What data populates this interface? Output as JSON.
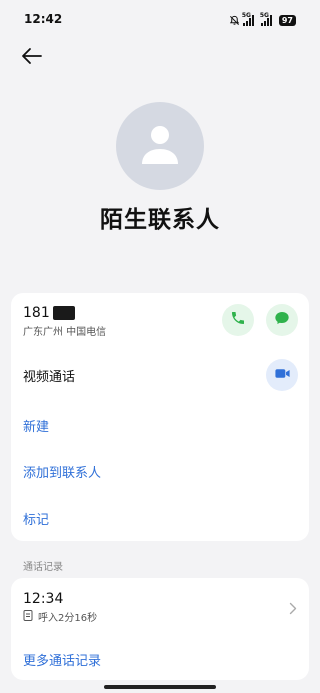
{
  "status_bar": {
    "time": "12:42",
    "sim1_tag": "5G",
    "sim2_tag": "5G",
    "battery": "97",
    "icons": [
      "bell-muted-icon",
      "signal-icon",
      "signal-icon",
      "battery-icon"
    ]
  },
  "header": {
    "back_icon": "arrow-left-icon"
  },
  "contact": {
    "avatar_icon": "person-icon",
    "name": "陌生联系人",
    "phone_number": "181",
    "location": "广东广州 中国电信"
  },
  "actions": {
    "call_icon": "phone-icon",
    "message_icon": "message-icon",
    "video_label": "视频通话",
    "video_icon": "video-camera-icon",
    "new_label": "新建",
    "add_to_contact_label": "添加到联系人",
    "mark_label": "标记"
  },
  "call_log": {
    "section_title": "通话记录",
    "entries": [
      {
        "time": "12:34",
        "detail": "呼入2分16秒",
        "icon": "call-incoming-icon"
      }
    ],
    "more_label": "更多通话记录"
  },
  "colors": {
    "accent_blue": "#3070d8",
    "accent_green": "#2fb24c",
    "background": "#f3f3f5"
  }
}
